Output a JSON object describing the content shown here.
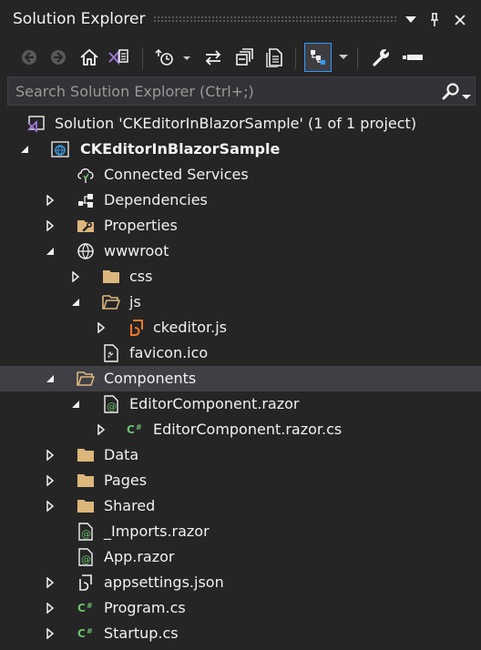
{
  "window": {
    "title": "Solution Explorer"
  },
  "search": {
    "placeholder": "Search Solution Explorer (Ctrl+;)"
  },
  "tree": {
    "solution": "Solution 'CKEditorInBlazorSample' (1 of 1 project)",
    "project": "CKEditorInBlazorSample",
    "connected_services": "Connected Services",
    "dependencies": "Dependencies",
    "properties": "Properties",
    "wwwroot": "wwwroot",
    "css": "css",
    "js": "js",
    "ckeditor_js": "ckeditor.js",
    "favicon": "favicon.ico",
    "components": "Components",
    "editor_razor": "EditorComponent.razor",
    "editor_razor_cs": "EditorComponent.razor.cs",
    "data": "Data",
    "pages": "Pages",
    "shared": "Shared",
    "imports": "_Imports.razor",
    "app_razor": "App.razor",
    "appsettings": "appsettings.json",
    "program": "Program.cs",
    "startup": "Startup.cs"
  },
  "colors": {
    "background": "#252526",
    "selected_row": "#3f3f46",
    "folder": "#dcb67a",
    "csharp": "#6bc26b",
    "js_file": "#f07a25",
    "vs_purple": "#a27bd8",
    "active_button": "#3399ff"
  }
}
